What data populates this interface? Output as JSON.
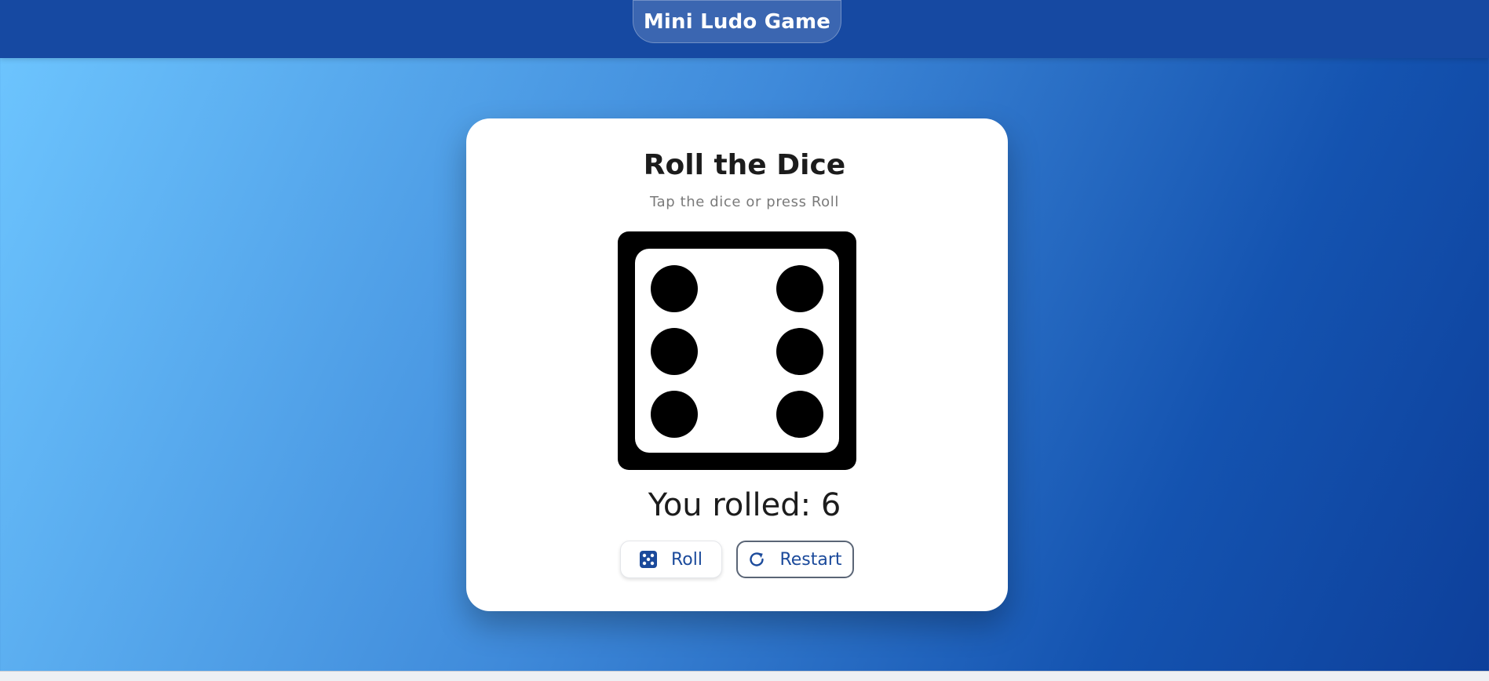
{
  "header": {
    "title": "Mini Ludo Game"
  },
  "card": {
    "title": "Roll the Dice",
    "subtitle": "Tap the dice or press Roll",
    "result_text": "You rolled: 6"
  },
  "dice": {
    "value": 6,
    "icon": "dice-six-icon"
  },
  "buttons": {
    "roll_label": "Roll",
    "roll_icon": "dice-icon",
    "restart_label": "Restart",
    "restart_icon": "refresh-icon"
  },
  "colors": {
    "header_bg": "#1649a2",
    "accent": "#1b4a9b",
    "card_bg": "#ffffff",
    "dice": "#000000"
  }
}
